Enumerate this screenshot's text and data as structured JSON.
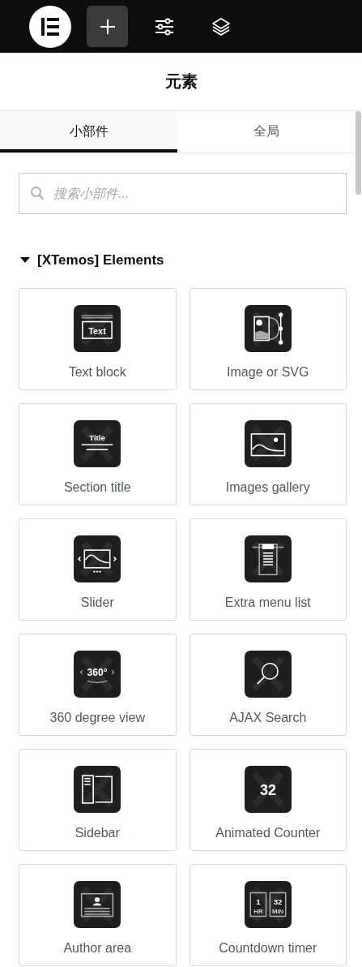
{
  "header": {
    "title": "元素"
  },
  "tabs": [
    {
      "label": "小部件",
      "selected": true
    },
    {
      "label": "全局",
      "selected": false
    }
  ],
  "search": {
    "placeholder": "搜索小部件..."
  },
  "section": {
    "title": "[XTemos] Elements",
    "expanded": true
  },
  "widgets": [
    {
      "label": "Text block",
      "icon": {
        "kind": "text"
      }
    },
    {
      "label": "Image or SVG",
      "icon": {
        "kind": "image"
      }
    },
    {
      "label": "Section title",
      "icon": {
        "kind": "title"
      }
    },
    {
      "label": "Images gallery",
      "icon": {
        "kind": "gallery"
      }
    },
    {
      "label": "Slider",
      "icon": {
        "kind": "slider"
      }
    },
    {
      "label": "Extra menu list",
      "icon": {
        "kind": "menu"
      }
    },
    {
      "label": "360 degree view",
      "icon": {
        "kind": "rotate"
      }
    },
    {
      "label": "AJAX Search",
      "icon": {
        "kind": "search"
      }
    },
    {
      "label": "Sidebar",
      "icon": {
        "kind": "sidebar"
      }
    },
    {
      "label": "Animated Counter",
      "icon": {
        "kind": "counter"
      }
    },
    {
      "label": "Author area",
      "icon": {
        "kind": "author"
      }
    },
    {
      "label": "Countdown timer",
      "icon": {
        "kind": "countdown"
      }
    }
  ],
  "widget_icon_texts": [
    "Text",
    "Title",
    "360°",
    "32",
    "1",
    "32",
    "HR",
    "MIN"
  ]
}
